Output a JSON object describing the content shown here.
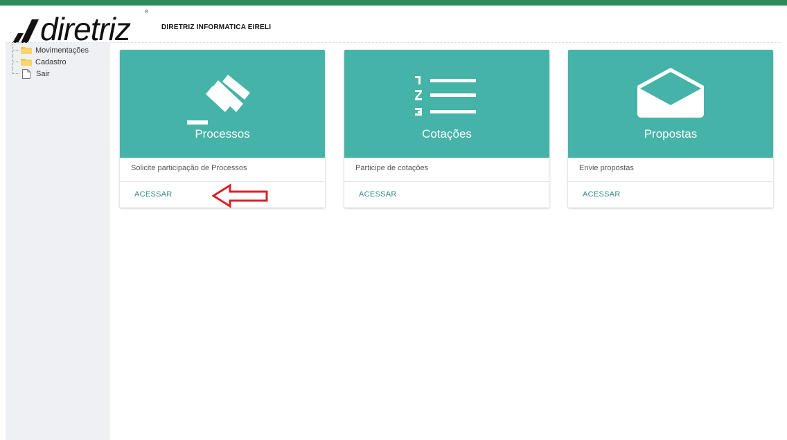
{
  "header": {
    "logo_text": "diretriz",
    "logo_reg": "®",
    "company_name": "DIRETRIZ INFORMATICA EIRELI"
  },
  "sidebar": {
    "items": [
      {
        "label": "Movimentações",
        "icon": "folder-icon"
      },
      {
        "label": "Cadastro",
        "icon": "folder-icon"
      },
      {
        "label": "Sair",
        "icon": "document-icon"
      }
    ]
  },
  "cards": [
    {
      "title": "Processos",
      "icon": "gavel-icon",
      "description": "Solicite participação de Processos",
      "action": "ACESSAR"
    },
    {
      "title": "Cotações",
      "icon": "numbered-list-icon",
      "description": "Participe de cotações",
      "action": "ACESSAR"
    },
    {
      "title": "Propostas",
      "icon": "open-envelope-icon",
      "description": "Envie propostas",
      "action": "ACESSAR"
    }
  ],
  "colors": {
    "top_bar": "#2e8b57",
    "card_media": "#45b3a8",
    "action_text": "#2e8b7f",
    "sidebar_bg": "#eef0f4",
    "annotation_arrow": "#d9202a"
  }
}
